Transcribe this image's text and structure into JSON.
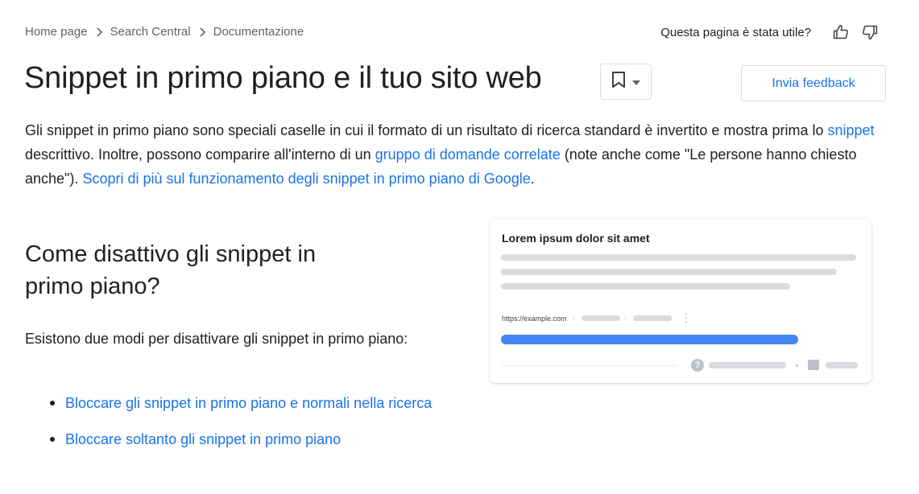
{
  "breadcrumb": {
    "items": [
      "Home page",
      "Search Central",
      "Documentazione"
    ]
  },
  "helpful": {
    "question": "Questa pagina è stata utile?"
  },
  "page": {
    "title": "Snippet in primo piano e il tuo sito web",
    "feedback_label": "Invia feedback"
  },
  "intro": {
    "t1": "Gli snippet in primo piano sono speciali caselle in cui il formato di un risultato di ricerca standard è invertito e mostra prima lo ",
    "link1": "snippet",
    "t2": " descrittivo. Inoltre, possono comparire all'interno di un ",
    "link2": "gruppo di domande correlate",
    "t3": " (note anche come \"Le persone hanno chiesto anche\"). ",
    "link3": "Scopri di più sul funzionamento degli snippet in primo piano di Google",
    "t4": "."
  },
  "section": {
    "heading": "Come disattivo gli snippet in primo piano?",
    "text": "Esistono due modi per disattivare gli snippet in primo piano:",
    "bullets": [
      "Bloccare gli snippet in primo piano e normali nella ricerca",
      "Bloccare soltanto gli snippet in primo piano"
    ]
  },
  "illustration": {
    "title": "Lorem ipsum dolor sit amet",
    "url": "https://example.com",
    "accent_color": "#4285f4"
  },
  "colors": {
    "link": "#1a73e8",
    "text": "#202124",
    "muted": "#5f6368"
  }
}
